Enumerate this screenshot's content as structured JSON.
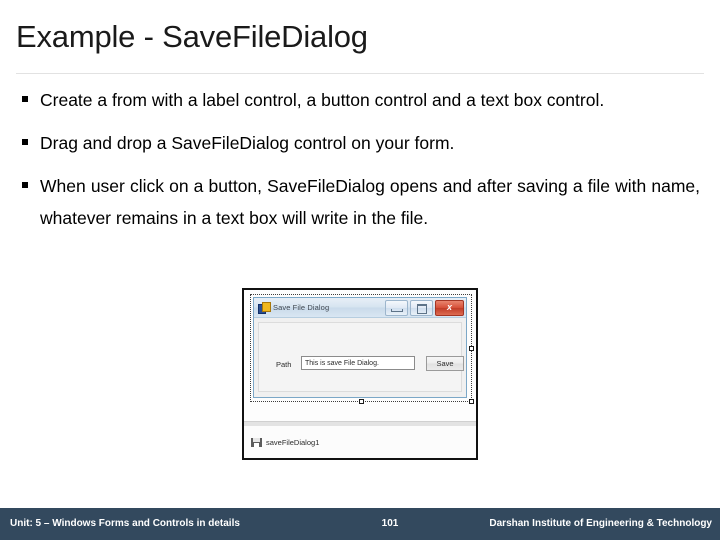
{
  "slide": {
    "title": "Example - SaveFileDialog",
    "bullets": [
      "Create a from with a label control, a button control and a text box control.",
      "Drag and drop a SaveFileDialog control on your form.",
      "When user click on a button, SaveFileDialog opens and after saving a file with name, whatever remains in a text box will write in the file."
    ]
  },
  "designer": {
    "form": {
      "title": "Save File Dialog",
      "icon": "winforms-app-icon",
      "buttons": {
        "minimize": "minimize-icon",
        "maximize": "maximize-icon",
        "close": "x"
      },
      "label_path": "Path",
      "textbox_value": "This is save File Dialog.",
      "button_save": "Save"
    },
    "tray": {
      "component_name": "saveFileDialog1",
      "icon": "savefiledialog-component-icon"
    }
  },
  "footer": {
    "unit": "Unit: 5 – Windows Forms and Controls in details",
    "page": "101",
    "institute": "Darshan Institute of Engineering & Technology",
    "background": "#33495e"
  }
}
